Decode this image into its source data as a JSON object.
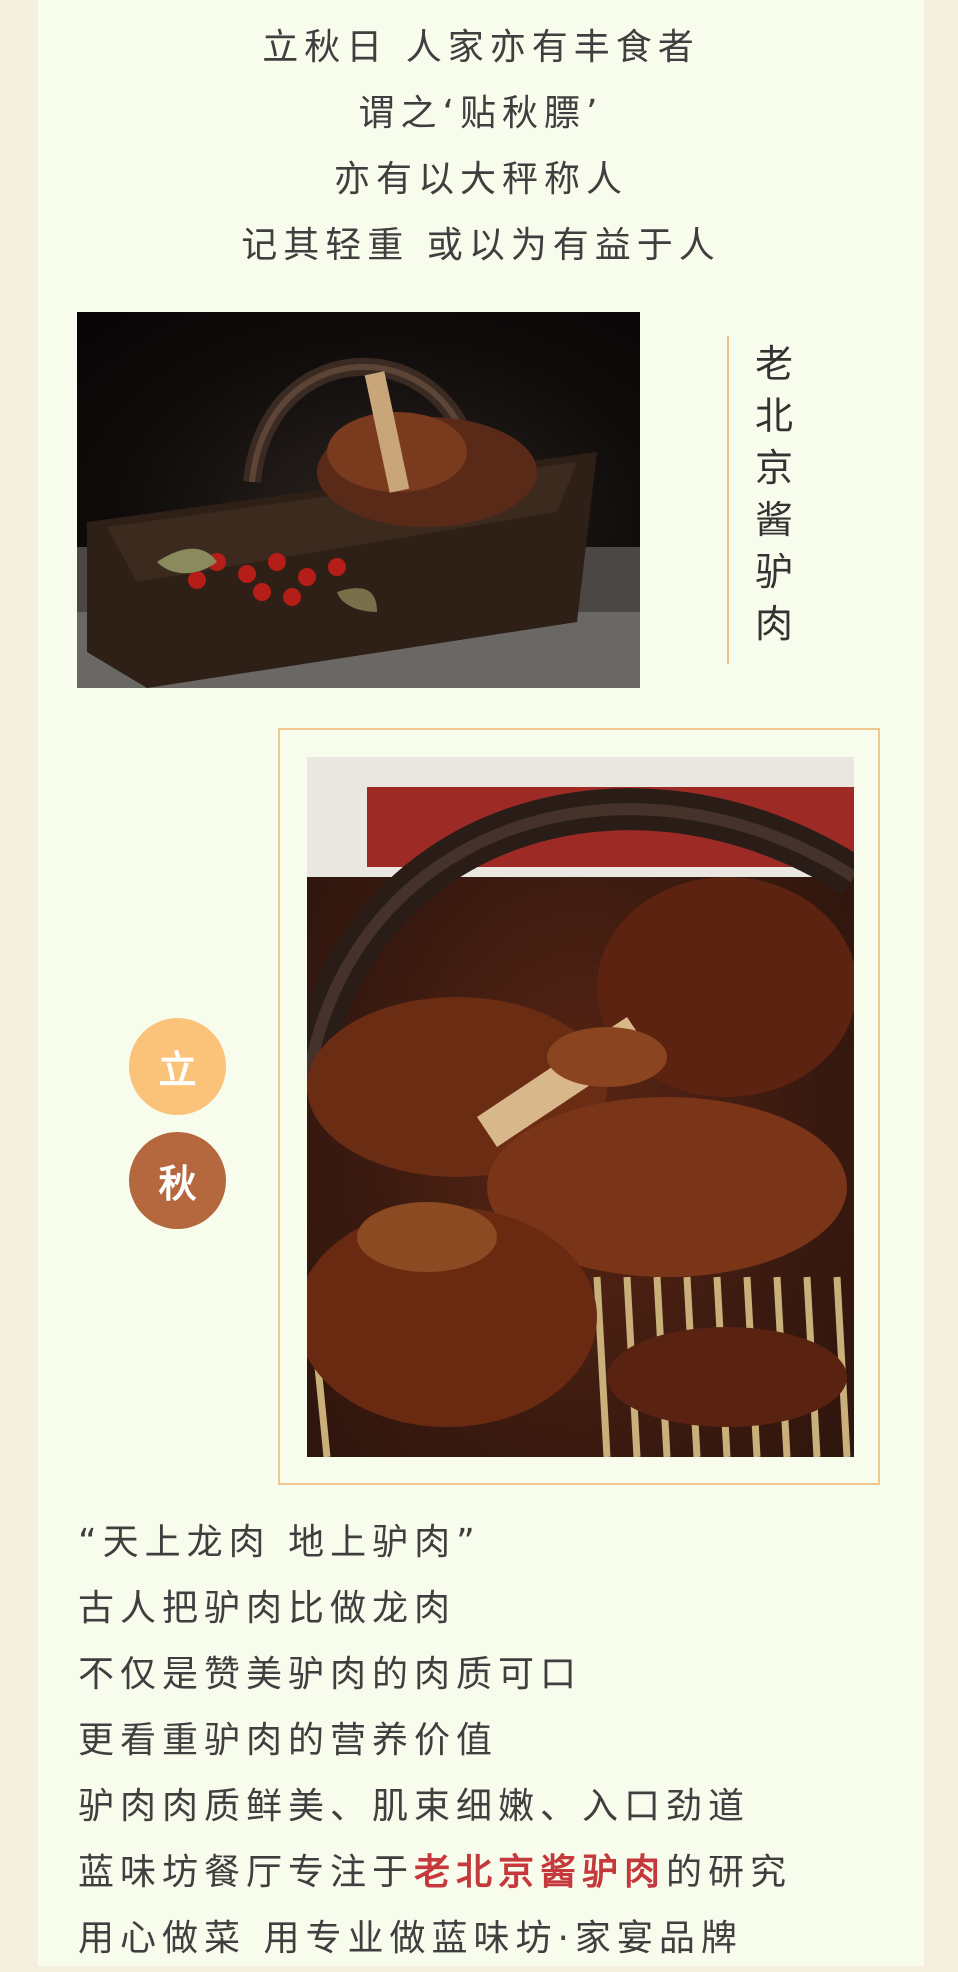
{
  "intro": {
    "lines": [
      "立秋日 人家亦有丰食者",
      "谓之‘贴秋膘’",
      "亦有以大秤称人",
      "记其轻重 或以为有益于人"
    ]
  },
  "dish": {
    "vertical_title": [
      "老",
      "北",
      "京",
      "酱",
      "驴",
      "肉"
    ]
  },
  "badges": [
    "立",
    "秋"
  ],
  "body": {
    "lines": [
      "“天上龙肉 地上驴肉”",
      "古人把驴肉比做龙肉",
      "不仅是赞美驴肉的肉质可口",
      "更看重驴肉的营养价值",
      "驴肉肉质鲜美、肌束细嫩、入口劲道"
    ],
    "line6_before": "蓝味坊餐厅专注于",
    "line6_highlight": "老北京酱驴肉",
    "line6_after": "的研究",
    "line7": "用心做菜 用专业做蓝味坊·家宴品牌"
  },
  "colors": {
    "page_bg": "#f7fcec",
    "outer_bg": "#f5efdf",
    "accent_gold": "#efc18a",
    "badge_light": "#fbc279",
    "badge_dark": "#b5683e",
    "highlight": "#c5383b"
  }
}
